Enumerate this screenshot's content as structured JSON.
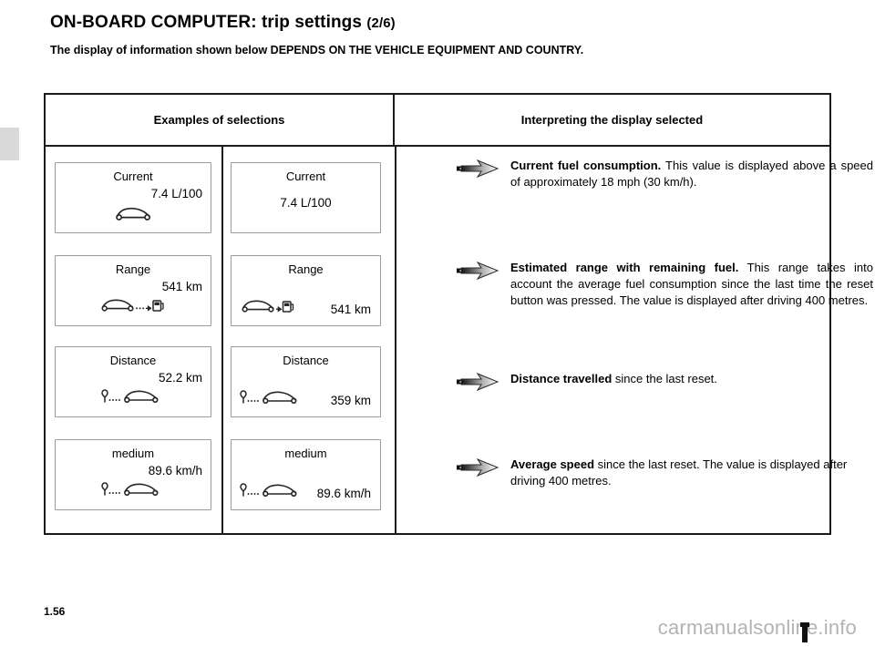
{
  "page": {
    "title_main": "ON-BOARD COMPUTER: trip settings",
    "title_fraction": "(2/6)",
    "subtitle": "The display of information shown below DEPENDS ON THE VEHICLE EQUIPMENT AND COUNTRY.",
    "folio": "1.56",
    "watermark": "carmanualsonline.info"
  },
  "table": {
    "headers": {
      "left": "Examples of selections",
      "right": "Interpreting the display selected"
    },
    "rows": [
      {
        "variant_a": {
          "title": "Current",
          "value": "7.4 L/100",
          "icon": "car-icon"
        },
        "variant_b": {
          "title": "Current",
          "value": "7.4 L/100",
          "icon": "none"
        },
        "description": {
          "lead": "Current fuel consumption.",
          "body": "This value is displayed above a speed of approximately 18 mph (30 km/h)."
        }
      },
      {
        "variant_a": {
          "title": "Range",
          "value": "541 km",
          "icon": "car-to-fuel-pump-icon"
        },
        "variant_b": {
          "title": "Range",
          "value": "541 km",
          "icon": "car-to-fuel-pump-icon"
        },
        "description": {
          "lead": "Estimated range with remaining fuel.",
          "body": "This range takes into account the average fuel consumption since the last time the reset button was pressed. The value is displayed after driving 400 metres."
        }
      },
      {
        "variant_a": {
          "title": "Distance",
          "value": "52.2 km",
          "icon": "pin-to-car-icon"
        },
        "variant_b": {
          "title": "Distance",
          "value": "359 km",
          "icon": "pin-to-car-icon"
        },
        "description": {
          "lead": "Distance travelled",
          "body": " since the last reset."
        }
      },
      {
        "variant_a": {
          "title": "medium",
          "value": "89.6 km/h",
          "icon": "pin-to-car-icon"
        },
        "variant_b": {
          "title": "medium",
          "value": "89.6 km/h",
          "icon": "pin-to-car-icon"
        },
        "description": {
          "lead": "Average speed",
          "body": " since the last reset. The value is displayed after driving 400 metres."
        }
      }
    ]
  },
  "icons": {
    "arrow": "arrow-right-icon",
    "car": "car-icon",
    "fuel_pump": "fuel-pump-icon",
    "pin": "location-pin-icon"
  },
  "colors": {
    "rule": "#1a1a1a",
    "screen_border": "#9a9a9a",
    "edge_tab": "#d9d9d9",
    "watermark": "#b3b3b3"
  }
}
